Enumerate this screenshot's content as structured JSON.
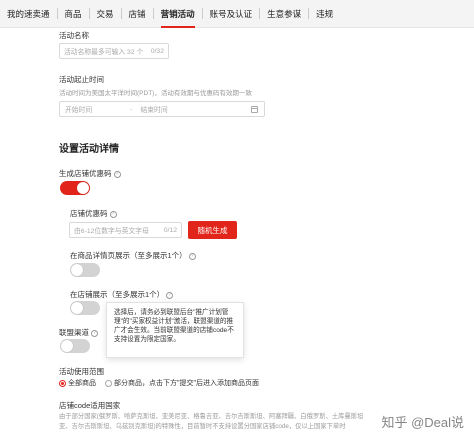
{
  "nav": {
    "items": [
      "我的速卖通",
      "商品",
      "交易",
      "店铺",
      "营销活动",
      "账号及认证",
      "生意参谋",
      "违规"
    ]
  },
  "activity_name": {
    "label": "活动名称",
    "placeholder": "活动名称最多可输入 32 个",
    "counter": "0/32"
  },
  "activity_time": {
    "label": "活动起止时间",
    "hint": "活动时间为美国太平洋时间(PDT)，活动有效期与优惠码有效期一致",
    "start_placeholder": "开始时间",
    "end_placeholder": "结束时间"
  },
  "section_title": "设置活动详情",
  "generate_code": {
    "label": "生成店铺优惠码"
  },
  "store_code": {
    "label": "店铺优惠码",
    "placeholder": "由6-12位数字与英文字母",
    "counter": "0/12",
    "random_button": "随机生成"
  },
  "show_on_product": {
    "label": "在商品详情页展示（至多展示1个）"
  },
  "show_on_store": {
    "label": "在店铺展示（至多展示1个）"
  },
  "tooltip": {
    "text": "选择后，请务必到联盟后台\"推广计划管理\"的\"买家权益计划\"激活，联盟渠道的推广才会生效。当前联盟渠道的店铺code不支持设置为限定国家。"
  },
  "alliance": {
    "label": "联盟渠道"
  },
  "scope": {
    "label": "活动使用范围",
    "option_all": "全部商品",
    "option_partial": "部分商品，点击下方\"提交\"后进入添加商品页面"
  },
  "country": {
    "label": "店铺code适用国家",
    "text_line1": "由于部分国家(俄罗斯、哈萨克斯坦、亚美尼亚、格鲁吉亚、吉尔吉斯斯坦、阿塞拜疆、白俄罗斯、土库曼斯坦",
    "text_line2": "亚、吉尔吉斯斯坦、乌兹别克斯坦)的特殊性，目前暂时不支持设置分国家店铺code，仅以上国家下单时"
  },
  "watermark": "知乎 @Deal说",
  "colors": {
    "accent": "#e1251b",
    "toggle_off": "#d3d3d3"
  }
}
